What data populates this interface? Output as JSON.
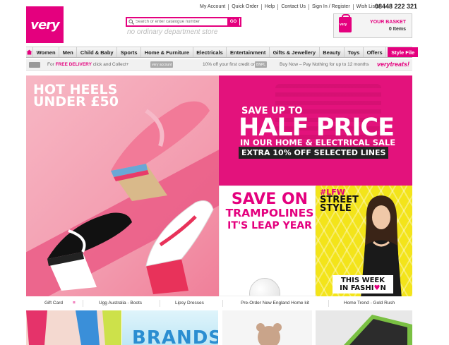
{
  "header": {
    "logo_text": "very",
    "top_links": [
      "My Account",
      "Quick Order",
      "Help",
      "Contact Us",
      "Sign In / Register",
      "Wish Lists"
    ],
    "phone": "08448 222 321",
    "search_placeholder": "Search or enter catalogue number",
    "search_button": "GO",
    "tagline": "no ordinary department store",
    "basket_title": "YOUR BASKET",
    "basket_count": "0 Items",
    "basket_icon_text": "very"
  },
  "nav": {
    "items": [
      "Women",
      "Men",
      "Child & Baby",
      "Sports",
      "Home & Furniture",
      "Electricals",
      "Entertainment",
      "Gifts & Jewellery",
      "Beauty",
      "Toys",
      "Offers"
    ],
    "highlight": "Style File"
  },
  "promo": {
    "delivery_prefix": "For",
    "delivery_bold": "FREE DELIVERY",
    "delivery_suffix": "click and Collect+",
    "chip1": "very account",
    "credit": "10% off your first credit order",
    "chip2": "BNPL",
    "bnpl": "Buy Now – Pay Nothing for up to 12 months",
    "treats": "verytreats!"
  },
  "banners": {
    "heels_line1": "HOT HEELS",
    "heels_line2": "UNDER £50",
    "half_line1": "SAVE UP TO",
    "half_line2": "HALF PRICE",
    "half_line3": "IN OUR HOME & ELECTRICAL SALE",
    "half_line4": "EXTRA 10% OFF SELECTED LINES",
    "tramp_line1a": "SAVE ON",
    "tramp_line2a": "TRAMPOLINES",
    "tramp_line2b": "IT'S LEAP YEAR",
    "lfw_tag": "#LFW",
    "lfw_title": "STREET STYLE",
    "lfw_foot1": "THIS WEEK",
    "lfw_foot2a": "IN FASHI",
    "lfw_heart": "♥",
    "lfw_foot2b": "N"
  },
  "strip_links": [
    "Gift Card",
    "Ugg Australia - Boots",
    "Lipsy Dresses",
    "Pre-Order New England Home kit",
    "Home Trend - Gold Rush"
  ],
  "tiles": {
    "brands": "BRANDS"
  },
  "colors": {
    "brand": "#e4007e",
    "lfw_bg": "#f3e41a"
  }
}
